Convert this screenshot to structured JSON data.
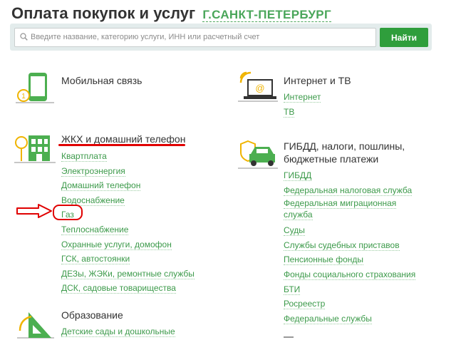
{
  "page": {
    "title": "Оплата покупок и услуг",
    "city": "Г.САНКТ-ПЕТЕРБУРГ"
  },
  "search": {
    "placeholder": "Введите название, категорию услуги, ИНН или расчетный счет",
    "button": "Найти"
  },
  "colors": {
    "accent": "#2f9e3c",
    "link": "#3c9a4a",
    "annotation": "#e00000"
  },
  "categories": {
    "mobile": {
      "title": "Мобильная связь",
      "icon": "mobile-phone-icon",
      "links": []
    },
    "internet": {
      "title": "Интернет и ТВ",
      "icon": "laptop-wifi-icon",
      "links": [
        "Интернет",
        "ТВ"
      ]
    },
    "housing": {
      "title": "ЖКХ и домашний телефон",
      "icon": "house-tree-icon",
      "links": [
        "Квартплата",
        "Электроэнергия",
        "Домашний телефон",
        "Водоснабжение",
        "Газ",
        "Теплоснабжение",
        "Охранные услуги, домофон",
        "ГСК, автостоянки",
        "ДЕЗы, ЖЭКи, ремонтные службы",
        "ДСК, садовые товарищества"
      ]
    },
    "gibdd": {
      "title_line1": "ГИБДД, налоги, пошлины,",
      "title_line2": "бюджетные платежи",
      "icon": "car-shield-icon",
      "links": [
        "ГИБДД",
        "Федеральная налоговая служба",
        "Федеральная миграционная",
        "служба",
        "Суды",
        "Службы судебных приставов",
        "Пенсионные фонды",
        "Фонды социального страхования",
        "БТИ",
        "Росреестр",
        "Федеральные службы"
      ]
    },
    "education": {
      "title": "Образование",
      "icon": "ruler-triangle-icon",
      "links": [
        "Детские сады и дошкольные"
      ]
    }
  }
}
